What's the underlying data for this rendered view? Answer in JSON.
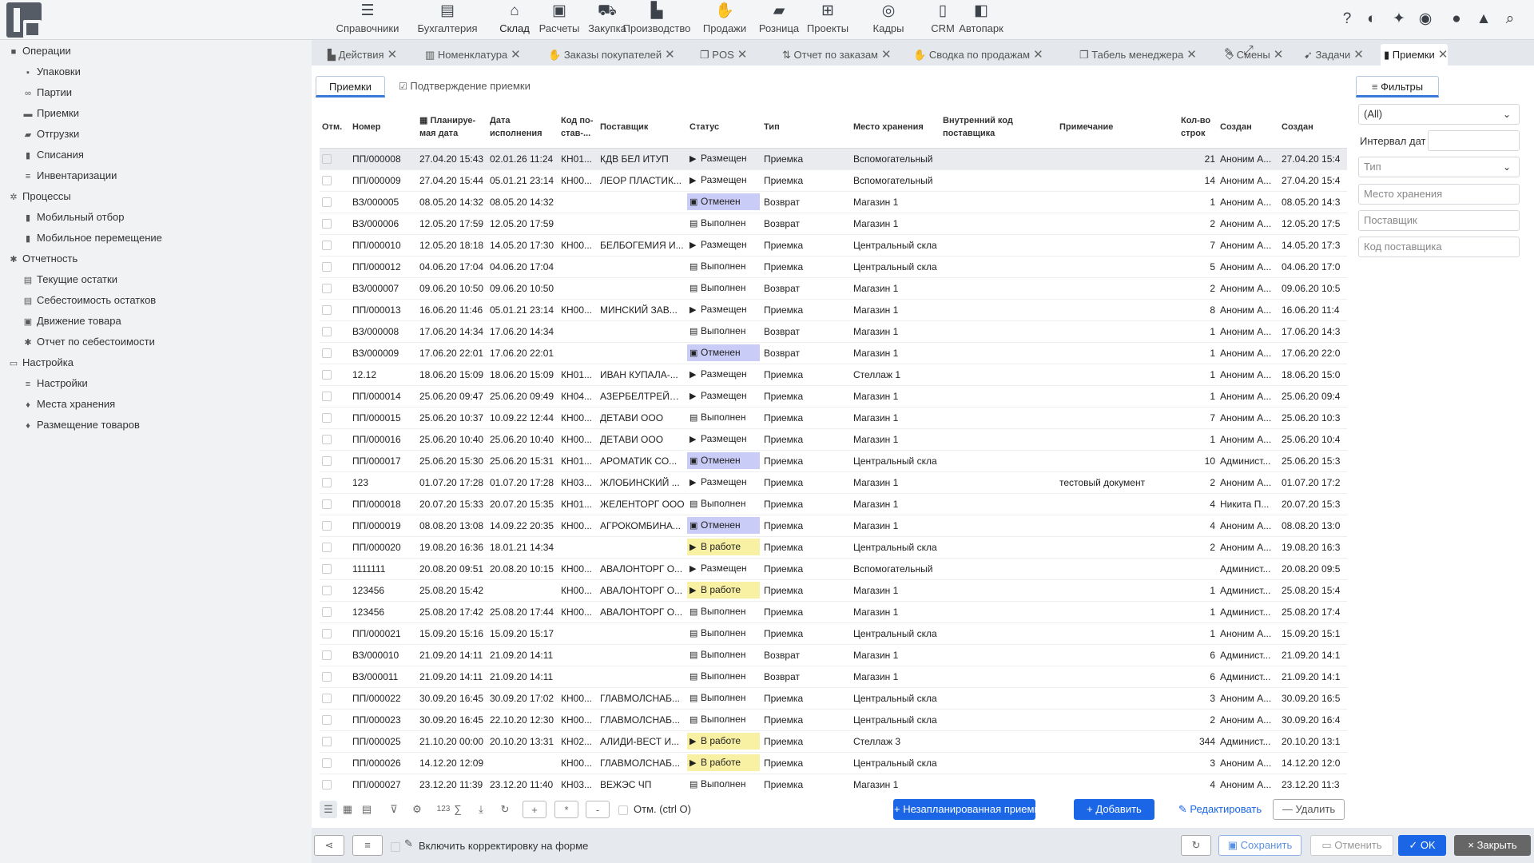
{
  "modules": [
    {
      "label": "Справочники",
      "icon": "list-icon",
      "glyph": "☰"
    },
    {
      "label": "Бухгалтерия",
      "icon": "document-icon",
      "glyph": "▤"
    },
    {
      "label": "Склад",
      "icon": "warehouse-icon",
      "glyph": "⌂"
    },
    {
      "label": "Расчеты",
      "icon": "money-icon",
      "glyph": "▣"
    },
    {
      "label": "Закупка",
      "icon": "truck-icon",
      "glyph": "⛟"
    },
    {
      "label": "Производство",
      "icon": "factory-icon",
      "glyph": "▙"
    },
    {
      "label": "Продажи",
      "icon": "hand-coin-icon",
      "glyph": "✋"
    },
    {
      "label": "Розница",
      "icon": "shopping-bag-icon",
      "glyph": "▰"
    },
    {
      "label": "Проекты",
      "icon": "hierarchy-icon",
      "glyph": "⊞"
    },
    {
      "label": "Кадры",
      "icon": "fingerprint-icon",
      "glyph": "◎"
    },
    {
      "label": "CRM",
      "icon": "contact-card-icon",
      "glyph": "▯"
    },
    {
      "label": "Автопарк",
      "icon": "bus-icon",
      "glyph": "◧"
    }
  ],
  "tools": [
    {
      "icon": "help-icon",
      "glyph": "?"
    },
    {
      "icon": "contrast-icon",
      "glyph": "◐"
    },
    {
      "icon": "pin-icon",
      "glyph": "✦"
    },
    {
      "icon": "eye-icon",
      "glyph": "◉"
    },
    {
      "icon": "chat-icon",
      "glyph": "●"
    },
    {
      "icon": "lock-icon",
      "glyph": "▲"
    },
    {
      "icon": "search-icon",
      "glyph": "⌕"
    }
  ],
  "sidebar": {
    "groups": [
      {
        "label": "Операции",
        "icon": "folder-icon",
        "glyph": "■",
        "items": [
          {
            "label": "Упаковки",
            "icon": "box-icon",
            "glyph": "▪"
          },
          {
            "label": "Партии",
            "icon": "batch-icon",
            "glyph": "∞"
          },
          {
            "label": "Приемки",
            "icon": "inbox-icon",
            "glyph": "▬"
          },
          {
            "label": "Отгрузки",
            "icon": "truck-icon",
            "glyph": "▰"
          },
          {
            "label": "Списания",
            "icon": "trash-icon",
            "glyph": "▮"
          },
          {
            "label": "Инвентаризации",
            "icon": "checklist-icon",
            "glyph": "≡"
          }
        ]
      },
      {
        "label": "Процессы",
        "icon": "gear-icon",
        "glyph": "✲",
        "items": [
          {
            "label": "Мобильный отбор",
            "icon": "phone-icon",
            "glyph": "▮"
          },
          {
            "label": "Мобильное перемещение",
            "icon": "phone-icon",
            "glyph": "▮"
          }
        ]
      },
      {
        "label": "Отчетность",
        "icon": "bug-icon",
        "glyph": "✱",
        "items": [
          {
            "label": "Текущие остатки",
            "icon": "table-icon",
            "glyph": "▤"
          },
          {
            "label": "Себестоимость остатков",
            "icon": "table-icon",
            "glyph": "▤"
          },
          {
            "label": "Движение товара",
            "icon": "lock-icon",
            "glyph": "▣"
          },
          {
            "label": "Отчет по себестоимости",
            "icon": "bug-icon",
            "glyph": "✱"
          }
        ]
      },
      {
        "label": "Настройка",
        "icon": "folder-open-icon",
        "glyph": "▭",
        "items": [
          {
            "label": "Настройки",
            "icon": "sliders-icon",
            "glyph": "≡"
          },
          {
            "label": "Места хранения",
            "icon": "pin-icon",
            "glyph": "♦"
          },
          {
            "label": "Размещение товаров",
            "icon": "pin-icon",
            "glyph": "♦"
          }
        ]
      }
    ]
  },
  "tabs": [
    {
      "label": "Действия",
      "icon": "chart-icon",
      "glyph": "▙"
    },
    {
      "label": "Номенклатура",
      "icon": "barcode-icon",
      "glyph": "▥"
    },
    {
      "label": "Заказы покупателей",
      "icon": "hand-icon",
      "glyph": "✋"
    },
    {
      "label": "POS",
      "icon": "copy-icon",
      "glyph": "❐"
    },
    {
      "label": "Отчет по заказам",
      "icon": "sort-icon",
      "glyph": "⇅"
    },
    {
      "label": "Сводка по продажам",
      "icon": "hand-icon",
      "glyph": "✋"
    },
    {
      "label": "Табель менеджера",
      "icon": "copy-icon",
      "glyph": "❐"
    },
    {
      "label": "Смены",
      "icon": "diamond-icon",
      "glyph": "◇"
    },
    {
      "label": "Задачи",
      "icon": "arrow-icon",
      "glyph": "➹"
    },
    {
      "label": "Приемки",
      "icon": "doc-icon",
      "glyph": "▮"
    }
  ],
  "subtabs": {
    "primary": "Приемки",
    "secondary": "Подтверждение приемки"
  },
  "columns": [
    "Отм.",
    "Номер",
    "Планируе-мая дата",
    "Дата исполнения",
    "Код по-став-...",
    "Поставщик",
    "Статус",
    "Тип",
    "Место хранения",
    "Внутренний код поставщика",
    "Примечание",
    "Кол-во строк",
    "Создан",
    "Создан"
  ],
  "rows": [
    {
      "num": "ПП/000008",
      "plan": "27.04.20 15:43",
      "exec": "02.01.26 11:24",
      "code": "КН01...",
      "supplier": "КДВ БЕЛ ИТУП",
      "status": "Размещен",
      "kind": "placed",
      "type": "Приемка",
      "place": "Вспомогательный",
      "note": "",
      "lines": "21",
      "by": "Аноним А...",
      "created": "27.04.20 15:4"
    },
    {
      "num": "ПП/000009",
      "plan": "27.04.20 15:44",
      "exec": "05.01.21 23:14",
      "code": "КН00...",
      "supplier": "ЛЕОР ПЛАСТИК...",
      "status": "Размещен",
      "kind": "placed",
      "type": "Приемка",
      "place": "Вспомогательный",
      "note": "",
      "lines": "14",
      "by": "Аноним А...",
      "created": "27.04.20 15:4"
    },
    {
      "num": "ВЗ/000005",
      "plan": "08.05.20 14:32",
      "exec": "08.05.20 14:32",
      "code": "",
      "supplier": "",
      "status": "Отменен",
      "kind": "cancel",
      "type": "Возврат",
      "place": "Магазин 1",
      "note": "",
      "lines": "1",
      "by": "Аноним А...",
      "created": "08.05.20 14:3"
    },
    {
      "num": "ВЗ/000006",
      "plan": "12.05.20 17:59",
      "exec": "12.05.20 17:59",
      "code": "",
      "supplier": "",
      "status": "Выполнен",
      "kind": "done",
      "type": "Возврат",
      "place": "Магазин 1",
      "note": "",
      "lines": "2",
      "by": "Аноним А...",
      "created": "12.05.20 17:5"
    },
    {
      "num": "ПП/000010",
      "plan": "12.05.20 18:18",
      "exec": "14.05.20 17:30",
      "code": "КН00...",
      "supplier": "БЕЛБОГЕМИЯ И...",
      "status": "Размещен",
      "kind": "placed",
      "type": "Приемка",
      "place": "Центральный скла",
      "note": "",
      "lines": "7",
      "by": "Аноним А...",
      "created": "14.05.20 17:3"
    },
    {
      "num": "ПП/000012",
      "plan": "04.06.20 17:04",
      "exec": "04.06.20 17:04",
      "code": "",
      "supplier": "",
      "status": "Выполнен",
      "kind": "done",
      "type": "Приемка",
      "place": "Центральный скла",
      "note": "",
      "lines": "5",
      "by": "Аноним А...",
      "created": "04.06.20 17:0"
    },
    {
      "num": "ВЗ/000007",
      "plan": "09.06.20 10:50",
      "exec": "09.06.20 10:50",
      "code": "",
      "supplier": "",
      "status": "Выполнен",
      "kind": "done",
      "type": "Возврат",
      "place": "Магазин 1",
      "note": "",
      "lines": "2",
      "by": "Аноним А...",
      "created": "09.06.20 10:5"
    },
    {
      "num": "ПП/000013",
      "plan": "16.06.20 11:46",
      "exec": "05.01.21 23:14",
      "code": "КН00...",
      "supplier": "МИНСКИЙ ЗАВ...",
      "status": "Размещен",
      "kind": "placed",
      "type": "Приемка",
      "place": "Магазин 1",
      "note": "",
      "lines": "8",
      "by": "Аноним А...",
      "created": "16.06.20 11:4"
    },
    {
      "num": "ВЗ/000008",
      "plan": "17.06.20 14:34",
      "exec": "17.06.20 14:34",
      "code": "",
      "supplier": "",
      "status": "Выполнен",
      "kind": "done",
      "type": "Возврат",
      "place": "Магазин 1",
      "note": "",
      "lines": "1",
      "by": "Аноним А...",
      "created": "17.06.20 14:3"
    },
    {
      "num": "ВЗ/000009",
      "plan": "17.06.20 22:01",
      "exec": "17.06.20 22:01",
      "code": "",
      "supplier": "",
      "status": "Отменен",
      "kind": "cancel",
      "type": "Возврат",
      "place": "Магазин 1",
      "note": "",
      "lines": "1",
      "by": "Аноним А...",
      "created": "17.06.20 22:0"
    },
    {
      "num": "12.12",
      "plan": "18.06.20 15:09",
      "exec": "18.06.20 15:09",
      "code": "КН01...",
      "supplier": "ИВАН КУПАЛА-...",
      "status": "Размещен",
      "kind": "placed",
      "type": "Приемка",
      "place": "Стеллаж 1",
      "note": "",
      "lines": "1",
      "by": "Аноним А...",
      "created": "18.06.20 15:0"
    },
    {
      "num": "ПП/000014",
      "plan": "25.06.20 09:47",
      "exec": "25.06.20 09:49",
      "code": "КН04...",
      "supplier": "АЗЕРБЕЛТРЕЙД ...",
      "status": "Размещен",
      "kind": "placed",
      "type": "Приемка",
      "place": "Магазин 1",
      "note": "",
      "lines": "1",
      "by": "Аноним А...",
      "created": "25.06.20 09:4"
    },
    {
      "num": "ПП/000015",
      "plan": "25.06.20 10:37",
      "exec": "10.09.22 12:44",
      "code": "КН00...",
      "supplier": "ДЕТАВИ ООО",
      "status": "Выполнен",
      "kind": "done",
      "type": "Приемка",
      "place": "Магазин 1",
      "note": "",
      "lines": "7",
      "by": "Аноним А...",
      "created": "25.06.20 10:3"
    },
    {
      "num": "ПП/000016",
      "plan": "25.06.20 10:40",
      "exec": "25.06.20 10:40",
      "code": "КН00...",
      "supplier": "ДЕТАВИ ООО",
      "status": "Размещен",
      "kind": "placed",
      "type": "Приемка",
      "place": "Магазин 1",
      "note": "",
      "lines": "1",
      "by": "Аноним А...",
      "created": "25.06.20 10:4"
    },
    {
      "num": "ПП/000017",
      "plan": "25.06.20 15:30",
      "exec": "25.06.20 15:31",
      "code": "КН01...",
      "supplier": "АРОМАТИК СО...",
      "status": "Отменен",
      "kind": "cancel",
      "type": "Приемка",
      "place": "Центральный скла",
      "note": "",
      "lines": "10",
      "by": "Админист...",
      "created": "25.06.20 15:3"
    },
    {
      "num": "123",
      "plan": "01.07.20 17:28",
      "exec": "01.07.20 17:28",
      "code": "КН03...",
      "supplier": "ЖЛОБИНСКИЙ ...",
      "status": "Размещен",
      "kind": "placed",
      "type": "Приемка",
      "place": "Магазин 1",
      "note": "тестовый документ",
      "lines": "2",
      "by": "Аноним А...",
      "created": "01.07.20 17:2"
    },
    {
      "num": "ПП/000018",
      "plan": "20.07.20 15:33",
      "exec": "20.07.20 15:35",
      "code": "КН01...",
      "supplier": "ЖЕЛЕНТОРГ ООО",
      "status": "Выполнен",
      "kind": "done",
      "type": "Приемка",
      "place": "Магазин 1",
      "note": "",
      "lines": "4",
      "by": "Никита П...",
      "created": "20.07.20 15:3"
    },
    {
      "num": "ПП/000019",
      "plan": "08.08.20 13:08",
      "exec": "14.09.22 20:35",
      "code": "КН00...",
      "supplier": "АГРОКОМБИНА...",
      "status": "Отменен",
      "kind": "cancel",
      "type": "Приемка",
      "place": "Магазин 1",
      "note": "",
      "lines": "4",
      "by": "Аноним А...",
      "created": "08.08.20 13:0"
    },
    {
      "num": "ПП/000020",
      "plan": "19.08.20 16:36",
      "exec": "18.01.21 14:34",
      "code": "",
      "supplier": "",
      "status": "В работе",
      "kind": "work",
      "type": "Приемка",
      "place": "Центральный скла",
      "note": "",
      "lines": "2",
      "by": "Аноним А...",
      "created": "19.08.20 16:3"
    },
    {
      "num": "1111111",
      "plan": "20.08.20 09:51",
      "exec": "20.08.20 10:15",
      "code": "КН00...",
      "supplier": "АВАЛОНТОРГ О...",
      "status": "Размещен",
      "kind": "placed",
      "type": "Приемка",
      "place": "Вспомогательный",
      "note": "",
      "lines": "",
      "by": "Админист...",
      "created": "20.08.20 09:5"
    },
    {
      "num": "123456",
      "plan": "25.08.20 15:42",
      "exec": "",
      "code": "КН00...",
      "supplier": "АВАЛОНТОРГ О...",
      "status": "В работе",
      "kind": "work",
      "type": "Приемка",
      "place": "Магазин 1",
      "note": "",
      "lines": "1",
      "by": "Админист...",
      "created": "25.08.20 15:4"
    },
    {
      "num": "123456",
      "plan": "25.08.20 17:42",
      "exec": "25.08.20 17:44",
      "code": "КН00...",
      "supplier": "АВАЛОНТОРГ О...",
      "status": "Выполнен",
      "kind": "done",
      "type": "Приемка",
      "place": "Магазин 1",
      "note": "",
      "lines": "1",
      "by": "Админист...",
      "created": "25.08.20 17:4"
    },
    {
      "num": "ПП/000021",
      "plan": "15.09.20 15:16",
      "exec": "15.09.20 15:17",
      "code": "",
      "supplier": "",
      "status": "Выполнен",
      "kind": "done",
      "type": "Приемка",
      "place": "Центральный скла",
      "note": "",
      "lines": "1",
      "by": "Аноним А...",
      "created": "15.09.20 15:1"
    },
    {
      "num": "ВЗ/000010",
      "plan": "21.09.20 14:11",
      "exec": "21.09.20 14:11",
      "code": "",
      "supplier": "",
      "status": "Выполнен",
      "kind": "done",
      "type": "Возврат",
      "place": "Магазин 1",
      "note": "",
      "lines": "6",
      "by": "Админист...",
      "created": "21.09.20 14:1"
    },
    {
      "num": "ВЗ/000011",
      "plan": "21.09.20 14:11",
      "exec": "21.09.20 14:11",
      "code": "",
      "supplier": "",
      "status": "Выполнен",
      "kind": "done",
      "type": "Возврат",
      "place": "Магазин 1",
      "note": "",
      "lines": "6",
      "by": "Админист...",
      "created": "21.09.20 14:1"
    },
    {
      "num": "ПП/000022",
      "plan": "30.09.20 16:45",
      "exec": "30.09.20 17:02",
      "code": "КН00...",
      "supplier": "ГЛАВМОЛСНАБ...",
      "status": "Выполнен",
      "kind": "done",
      "type": "Приемка",
      "place": "Центральный скла",
      "note": "",
      "lines": "3",
      "by": "Аноним А...",
      "created": "30.09.20 16:5"
    },
    {
      "num": "ПП/000023",
      "plan": "30.09.20 16:45",
      "exec": "22.10.20 12:30",
      "code": "КН00...",
      "supplier": "ГЛАВМОЛСНАБ...",
      "status": "Выполнен",
      "kind": "done",
      "type": "Приемка",
      "place": "Центральный скла",
      "note": "",
      "lines": "2",
      "by": "Аноним А...",
      "created": "30.09.20 16:4"
    },
    {
      "num": "ПП/000025",
      "plan": "21.10.20 00:00",
      "exec": "20.10.20 13:31",
      "code": "КН02...",
      "supplier": "АЛИДИ-ВЕСТ И...",
      "status": "В работе",
      "kind": "work",
      "type": "Приемка",
      "place": "Стеллаж 3",
      "note": "",
      "lines": "344",
      "by": "Админист...",
      "created": "20.10.20 13:1"
    },
    {
      "num": "ПП/000026",
      "plan": "14.12.20 12:09",
      "exec": "",
      "code": "КН00...",
      "supplier": "ГЛАВМОЛСНАБ...",
      "status": "В работе",
      "kind": "work",
      "type": "Приемка",
      "place": "Центральный скла",
      "note": "",
      "lines": "3",
      "by": "Аноним А...",
      "created": "14.12.20 12:0"
    },
    {
      "num": "ПП/000027",
      "plan": "23.12.20 11:39",
      "exec": "23.12.20 11:40",
      "code": "КН03...",
      "supplier": "ВЕЖЭС ЧП",
      "status": "Выполнен",
      "kind": "done",
      "type": "Приемка",
      "place": "Магазин 1",
      "note": "",
      "lines": "4",
      "by": "Аноним А...",
      "created": "23.12.20 11:3"
    }
  ],
  "gridbar": {
    "count_label": "123",
    "sum_label": "∑",
    "plus": "+",
    "mult": "*",
    "minus": "-",
    "mark_label": "Отм. (ctrl O)"
  },
  "actions": {
    "unplanned": "Незапланированная приемка",
    "add": "Добавить",
    "edit": "Редактировать",
    "delete": "Удалить"
  },
  "filters": {
    "tab": "Фильтры",
    "all_value": "(All)",
    "date_label": "Интервал дат",
    "type_placeholder": "Тип",
    "place_placeholder": "Место хранения",
    "supplier_placeholder": "Поставщик",
    "code_placeholder": "Код поставщика"
  },
  "bottom": {
    "allow_edit": "Включить корректировку на форме",
    "save": "Сохранить",
    "cancel": "Отменить",
    "ok": "OK",
    "close": "Закрыть"
  },
  "colors": {
    "accent": "#1a66e6",
    "cancel_bg": "#c8ccf6",
    "work_bg": "#f8f0a2",
    "selected_row": "#e9ebee"
  }
}
